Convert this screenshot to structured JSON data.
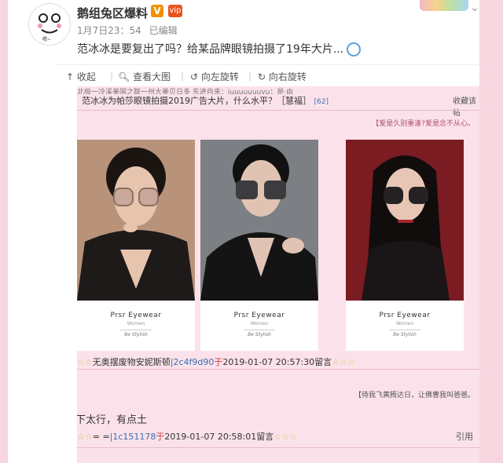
{
  "post": {
    "username": "鹅组兔区爆料",
    "verified_badge": "V",
    "vip_badge": "vip",
    "time": "1月7日23：54",
    "edited": "已编辑",
    "text": "范冰冰是要复出了吗？给某品牌眼镜拍摄了19年大片...",
    "avatar_caption": "嗯~"
  },
  "toolbar": {
    "items": [
      "收起",
      "查看大图",
      "向左旋转",
      "向右旋转"
    ]
  },
  "screenshot": {
    "truncated_top": "北极一冷溪美国之联一州大美贝日多                                    东进自来：iuuuuuuuyu；是·由",
    "thread_title": "范冰冰为帕莎眼镜拍摄2019广告大片，什么水平？［慧福］",
    "thread_count": "[62]",
    "favorite": "收藏该帖",
    "motto1": "【爱是久别重逢?爱是念不从心。",
    "brand": {
      "name": "Prsr Eyewear",
      "sub": "Women",
      "slogan": "Be Stylish"
    },
    "reply1": {
      "stars_left": "☆☆",
      "name": "无奥摆废物安妮斯顿",
      "id": "|2c4f9d90",
      "at": "于",
      "time": "2019-01-07 20:57:30",
      "tail": "留言",
      "stars_right": "☆☆☆"
    },
    "motto2": "【待我飞黄腾达日，让佛曹我叫爸爸。",
    "comment2": "下太行，有点土",
    "reply2": {
      "stars_left": "☆☆",
      "name": "= =",
      "id": "|1c151178",
      "at": "于",
      "time": "2019-01-07 20:58:01",
      "tail": "留言",
      "stars_right": "☆☆☆"
    },
    "quote": "引用"
  }
}
